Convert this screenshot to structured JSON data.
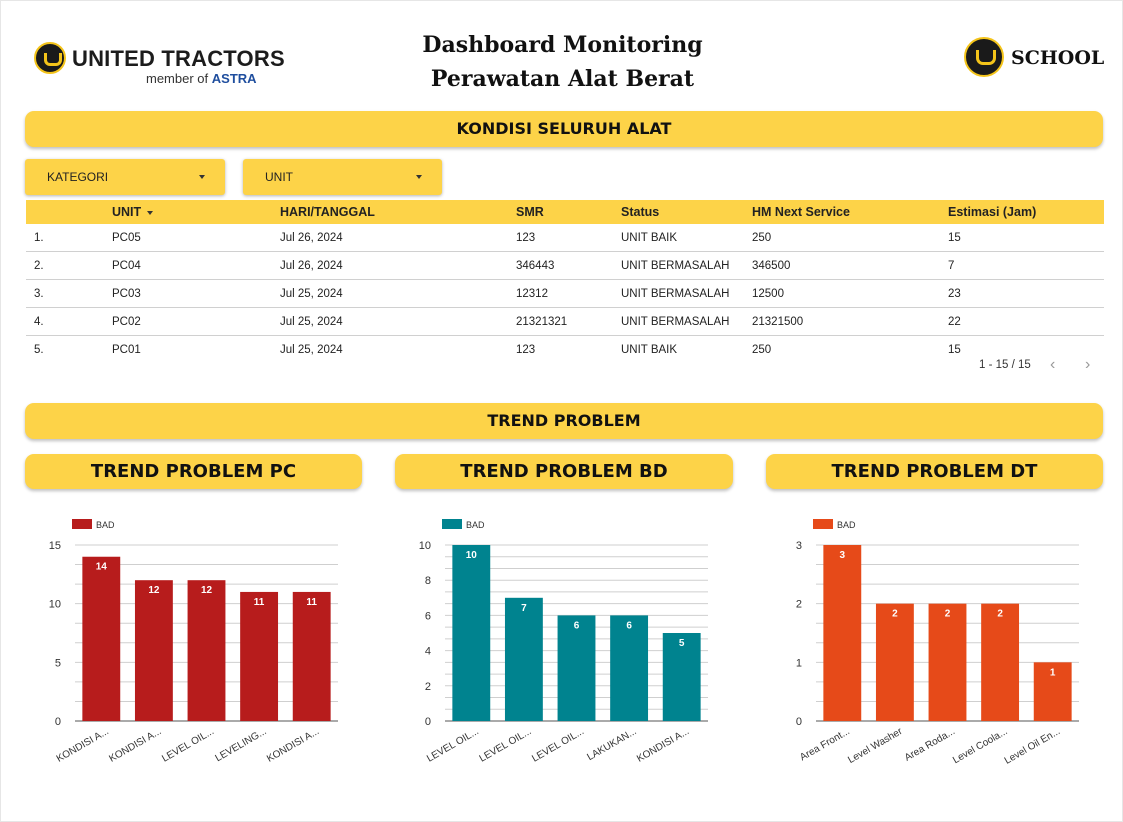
{
  "header": {
    "brand_name": "UNITED TRACTORS",
    "brand_member_prefix": "member of",
    "brand_member_name": "ASTRA",
    "title_line1": "Dashboard Monitoring",
    "title_line2": "Perawatan Alat Berat",
    "school_label": "SCHOOL"
  },
  "sections": {
    "kondisi": "KONDISI SELURUH ALAT",
    "trend": "TREND PROBLEM"
  },
  "filters": {
    "kategori": "KATEGORI",
    "unit": "UNIT"
  },
  "table": {
    "columns": [
      "",
      "UNIT",
      "HARI/TANGGAL",
      "SMR",
      "Status",
      "HM Next Service",
      "Estimasi (Jam)"
    ],
    "rows": [
      [
        "1.",
        "PC05",
        "Jul 26, 2024",
        "123",
        "UNIT BAIK",
        "250",
        "15"
      ],
      [
        "2.",
        "PC04",
        "Jul 26, 2024",
        "346443",
        "UNIT BERMASALAH",
        "346500",
        "7"
      ],
      [
        "3.",
        "PC03",
        "Jul 25, 2024",
        "12312",
        "UNIT BERMASALAH",
        "12500",
        "23"
      ],
      [
        "4.",
        "PC02",
        "Jul 25, 2024",
        "21321321",
        "UNIT BERMASALAH",
        "21321500",
        "22"
      ],
      [
        "5.",
        "PC01",
        "Jul 25, 2024",
        "123",
        "UNIT BAIK",
        "250",
        "15"
      ]
    ],
    "pagination": "1 - 15 / 15",
    "prev_icon": "chevron-left-icon",
    "next_icon": "chevron-right-icon"
  },
  "chart_data": [
    {
      "type": "bar",
      "title": "TREND PROBLEM PC",
      "categories": [
        "KONDISI A...",
        "KONDISI A...",
        "LEVEL OIL...",
        "LEVELING...",
        "KONDISI A..."
      ],
      "series": [
        {
          "name": "BAD",
          "values": [
            14,
            12,
            12,
            11,
            11
          ],
          "color": "#b71c1c"
        }
      ],
      "ylim": [
        0,
        15
      ],
      "yticks": [
        0,
        5,
        10,
        15
      ],
      "grid": true,
      "legend": "top-left"
    },
    {
      "type": "bar",
      "title": "TREND PROBLEM BD",
      "categories": [
        "LEVEL OIL...",
        "LEVEL OIL...",
        "LEVEL OIL...",
        "LAKUKAN...",
        "KONDISI A..."
      ],
      "series": [
        {
          "name": "BAD",
          "values": [
            10,
            7,
            6,
            6,
            5
          ],
          "color": "#00838f"
        }
      ],
      "ylim": [
        0,
        10
      ],
      "yticks": [
        0,
        2,
        4,
        6,
        8,
        10
      ],
      "grid": true,
      "legend": "top-left"
    },
    {
      "type": "bar",
      "title": "TREND PROBLEM DT",
      "categories": [
        "Area Front...",
        "Level Washer",
        "Area Roda...",
        "Level Coola...",
        "Level Oil En..."
      ],
      "series": [
        {
          "name": "BAD",
          "values": [
            3,
            2,
            2,
            2,
            1
          ],
          "color": "#e64a19"
        }
      ],
      "ylim": [
        0,
        3
      ],
      "yticks": [
        0,
        1,
        2,
        3
      ],
      "grid": true,
      "legend": "top-left"
    }
  ]
}
